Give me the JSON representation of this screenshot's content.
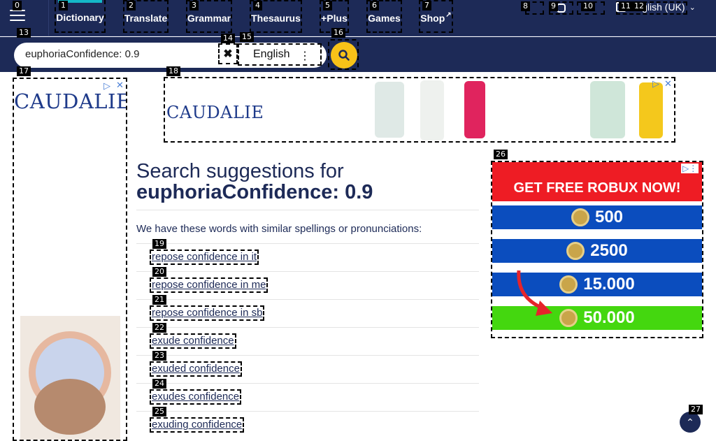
{
  "nav": {
    "items": [
      {
        "label": "Dictionary"
      },
      {
        "label": "Translate"
      },
      {
        "label": "Grammar"
      },
      {
        "label": "Thesaurus"
      },
      {
        "label": "+Plus"
      },
      {
        "label": "Games"
      },
      {
        "label": "Shop"
      }
    ],
    "language_label": "English (UK)"
  },
  "search": {
    "value": "euphoriaConfidence: 0.9",
    "language": "English"
  },
  "ads": {
    "brand": "CAUDALIE",
    "robux_title": "GET FREE ROBUX NOW!",
    "robux_amounts": [
      "500",
      "2500",
      "15.000",
      "50.000"
    ]
  },
  "main": {
    "heading_line1": "Search suggestions for",
    "heading_query": "euphoriaConfidence: 0.9",
    "intro": "We have these words with similar spellings or pronunciations:",
    "suggestions": [
      "repose confidence in it",
      "repose confidence in me",
      "repose confidence in sb",
      "exude confidence",
      "exuded confidence",
      "exudes confidence",
      "exuding confidence"
    ]
  },
  "badges": [
    "0",
    "1",
    "2",
    "3",
    "4",
    "5",
    "6",
    "7",
    "8",
    "9",
    "10",
    "11",
    "12",
    "13",
    "14",
    "15",
    "16",
    "17",
    "18",
    "19",
    "20",
    "21",
    "22",
    "23",
    "24",
    "25",
    "26",
    "27"
  ],
  "colors": {
    "navy": "#1d2a57",
    "accent_yellow": "#f8c218",
    "active_bar": "#14b8c8"
  }
}
